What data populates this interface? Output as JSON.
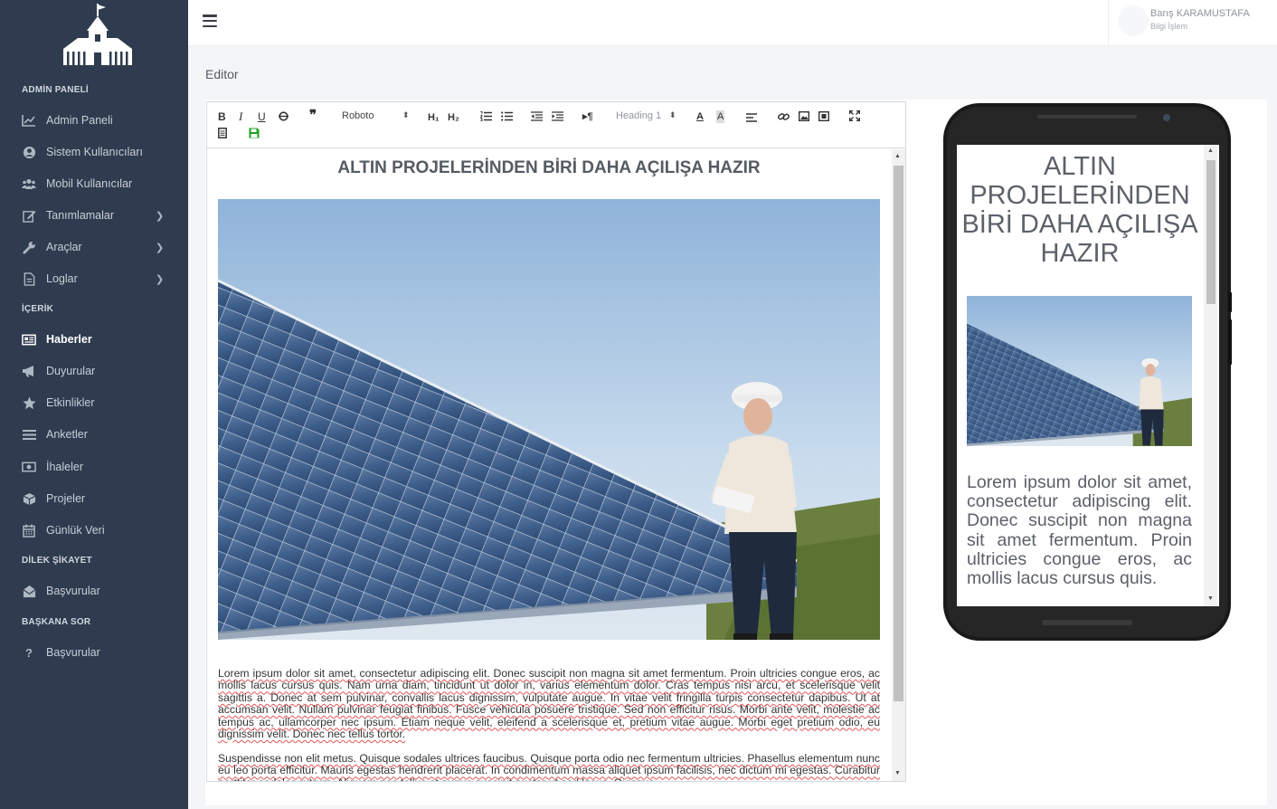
{
  "sidebar": {
    "sections": {
      "admin": "ADMİN PANELİ",
      "content": "İÇERİK",
      "complaints": "DİLEK ŞİKAYET",
      "ask": "BAŞKANA SOR"
    },
    "items": [
      {
        "label": "Admin Paneli",
        "icon": "chart-line-icon"
      },
      {
        "label": "Sistem Kullanıcıları",
        "icon": "user-circle-icon"
      },
      {
        "label": "Mobil Kullanıcılar",
        "icon": "users-icon"
      },
      {
        "label": "Tanımlamalar",
        "icon": "edit-icon"
      },
      {
        "label": "Araçlar",
        "icon": "wrench-icon"
      },
      {
        "label": "Loglar",
        "icon": "file-icon"
      },
      {
        "label": "Haberler",
        "icon": "newspaper-icon"
      },
      {
        "label": "Duyurular",
        "icon": "megaphone-icon"
      },
      {
        "label": "Etkinlikler",
        "icon": "star-icon"
      },
      {
        "label": "Anketler",
        "icon": "list-icon"
      },
      {
        "label": "İhaleler",
        "icon": "money-icon"
      },
      {
        "label": "Projeler",
        "icon": "cube-icon"
      },
      {
        "label": "Günlük Veri",
        "icon": "calendar-icon"
      },
      {
        "label": "Başvurular",
        "icon": "envelope-open-icon"
      },
      {
        "label": "Başvurular",
        "icon": "question-icon"
      }
    ]
  },
  "header": {
    "user_name": "Barış KARAMUSTAFA",
    "user_role": "Bilgi İşlem"
  },
  "page": {
    "title": "Editor"
  },
  "toolbar": {
    "font": "Roboto",
    "heading": "Heading 1",
    "h1": "H₁",
    "h2": "H₂"
  },
  "content": {
    "title": "ALTIN PROJELERİNDEN BİRİ DAHA AÇILIŞA HAZIR",
    "paragraph1": "Lorem ipsum dolor sit amet, consectetur adipiscing elit. Donec suscipit non magna sit amet fermentum. Proin ultricies congue eros, ac mollis lacus cursus quis. Nam urna diam, tincidunt ut dolor in, varius elementum dolor. Cras tempus nisi arcu, et scelerisque velit sagittis a. Donec at sem pulvinar, convallis lacus dignissim, vulputate augue. In vitae velit fringilla turpis consectetur dapibus. Ut at accumsan velit. Nullam pulvinar feugiat finibus. Fusce vehicula posuere tristique. Sed non efficitur risus. Morbi ante velit, molestie ac tempus ac, ullamcorper nec ipsum. Etiam neque velit, eleifend a scelerisque et, pretium vitae augue. Morbi eget pretium odio, eu dignissim velit. Donec nec tellus tortor.",
    "paragraph2": "Suspendisse non elit metus. Quisque sodales ultrices faucibus. Quisque porta odio nec fermentum ultricies. Phasellus elementum nunc eu leo porta efficitur. Mauris egestas hendrerit placerat. In condimentum massa aliquet ipsum facilisis, nec dictum mi egestas. Curabitur porttitor sodales rutrum. Aliquam nec tellus at augue suscipit auctor ut sed lacus. Quisque",
    "preview_paragraph": "Lorem ipsum dolor sit amet, consectetur adipiscing elit. Donec suscipit non magna sit amet fermentum. Proin ultricies congue eros, ac mollis lacus cursus quis."
  },
  "colors": {
    "sidebar_bg": "#2f3c4f",
    "spellcheck": "#e05555",
    "save_icon": "#1ea01e"
  }
}
